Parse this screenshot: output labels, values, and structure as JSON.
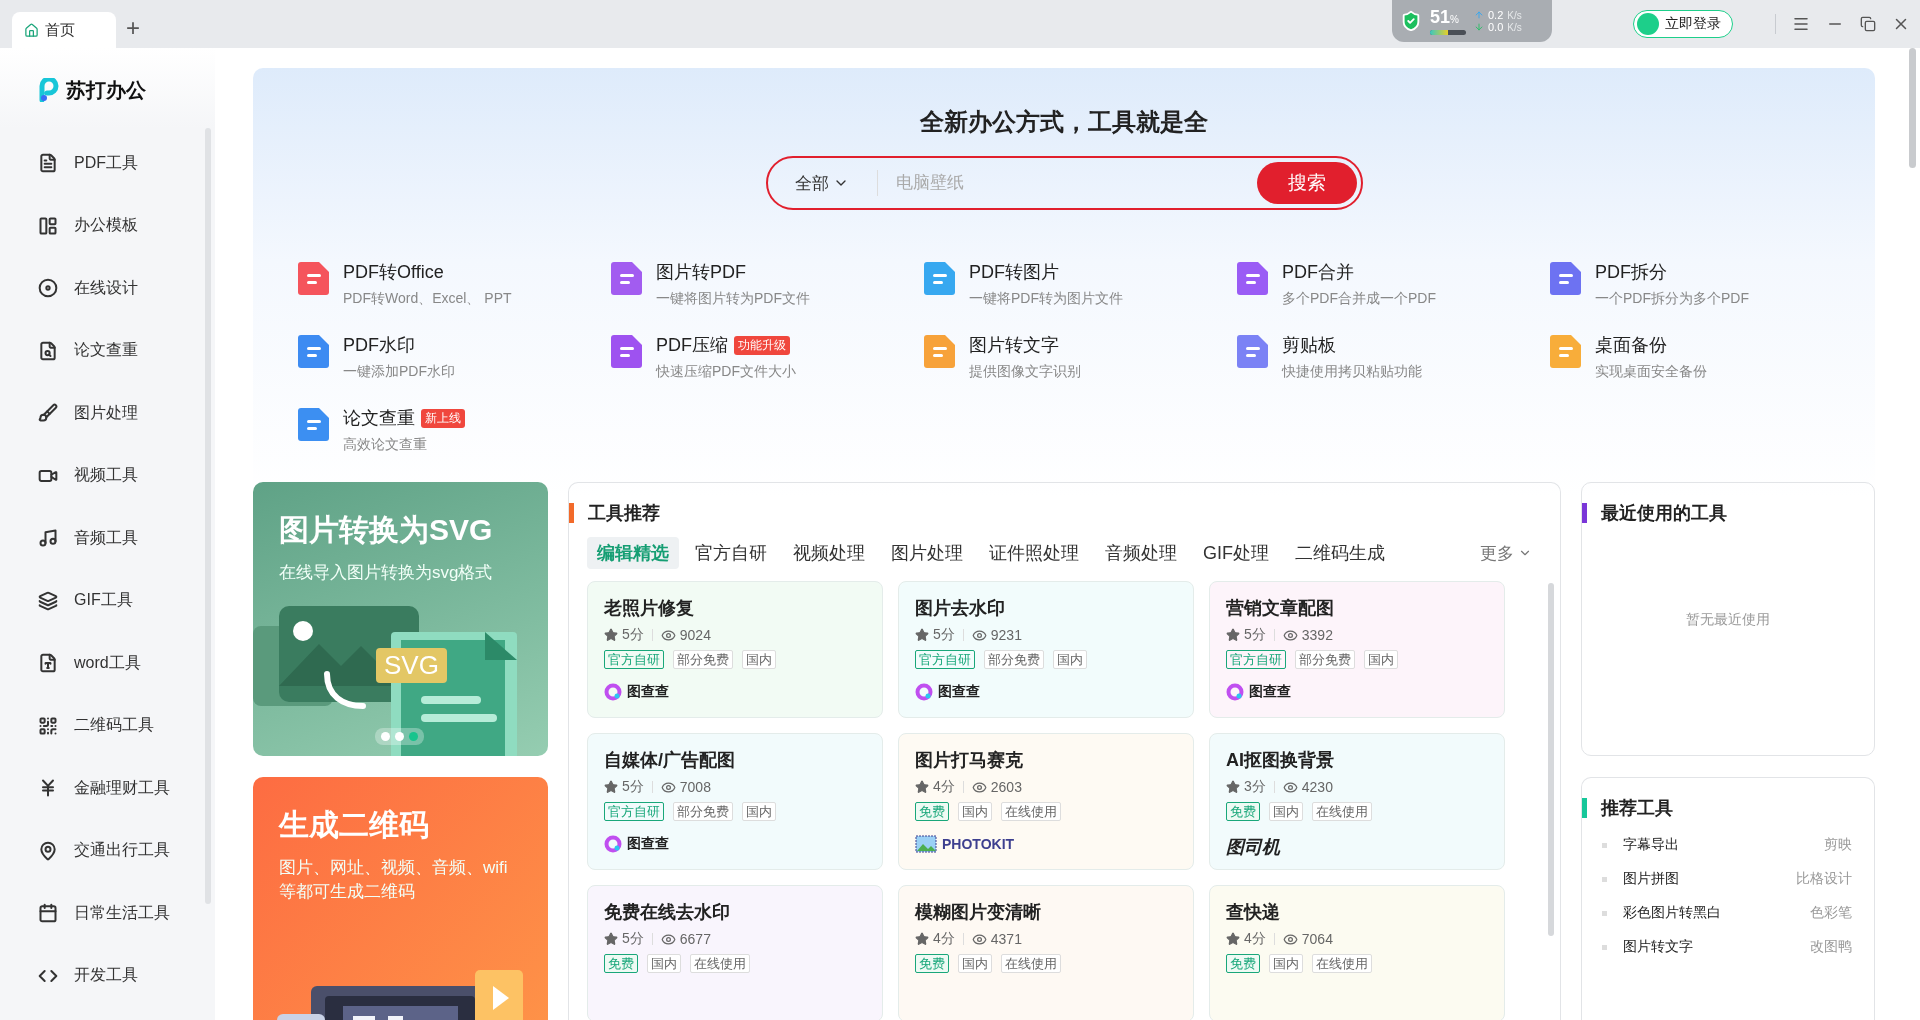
{
  "tabs": [
    {
      "label": "首页",
      "selected": true
    }
  ],
  "new_tab": "+",
  "status": {
    "percent": "51",
    "unit": "%",
    "level": 0.5,
    "upload": "0.2",
    "download": "0.0",
    "upload_unit": "K/s",
    "download_unit": "K/s"
  },
  "login": "立即登录",
  "sidebar": {
    "logo": "苏打办公",
    "items": [
      {
        "label": "PDF工具",
        "kind": "pdf"
      },
      {
        "label": "办公模板",
        "kind": "template"
      },
      {
        "label": "在线设计",
        "kind": "design"
      },
      {
        "label": "论文查重",
        "kind": "paper"
      },
      {
        "label": "图片处理",
        "kind": "image"
      },
      {
        "label": "视频工具",
        "kind": "video"
      },
      {
        "label": "音频工具",
        "kind": "audio"
      },
      {
        "label": "GIF工具",
        "kind": "gif"
      },
      {
        "label": "word工具",
        "kind": "word"
      },
      {
        "label": "二维码工具",
        "kind": "qr"
      },
      {
        "label": "金融理财工具",
        "kind": "finance"
      },
      {
        "label": "交通出行工具",
        "kind": "travel"
      },
      {
        "label": "日常生活工具",
        "kind": "daily"
      },
      {
        "label": "开发工具",
        "kind": "dev"
      }
    ]
  },
  "hero": {
    "title": "全新办公方式，工具就是全",
    "scope": "全部",
    "placeholder": "电脑壁纸",
    "button": "搜索"
  },
  "tools": [
    {
      "name": "PDF转Office",
      "desc": "PDF转Word、Excel、 PPT",
      "color": "#f5545c"
    },
    {
      "name": "图片转PDF",
      "desc": "一键将图片转为PDF文件",
      "color": "#a25cf0"
    },
    {
      "name": "PDF转图片",
      "desc": "一键将PDF转为图片文件",
      "color": "#37a8f0"
    },
    {
      "name": "PDF合并",
      "desc": "多个PDF合并成一个PDF",
      "color": "#9a5cf5"
    },
    {
      "name": "PDF拆分",
      "desc": "一个PDF拆分为多个PDF",
      "color": "#6d72f2"
    },
    {
      "name": "PDF水印",
      "desc": "一键添加PDF水印",
      "color": "#3d8bf2"
    },
    {
      "name": "PDF压缩",
      "desc": "快速压缩PDF文件大小",
      "badge": "功能升级",
      "color": "#9e52f0"
    },
    {
      "name": "图片转文字",
      "desc": "提供图像文字识别",
      "color": "#f7a23a"
    },
    {
      "name": "剪贴板",
      "desc": "快捷使用拷贝粘贴功能",
      "color": "#7b82f5"
    },
    {
      "name": "桌面备份",
      "desc": "实现桌面安全备份",
      "color": "#f8ad3a"
    },
    {
      "name": "论文查重",
      "desc": "高效论文查重",
      "badge": "新上线",
      "color": "#3c8ff2"
    }
  ],
  "banners": [
    {
      "kind": "svg",
      "title": "图片转换为SVG",
      "desc": "在线导入图片转换为svg格式",
      "label": "SVG",
      "dots": [
        {
          "selected": false
        },
        {
          "selected": false
        },
        {
          "selected": true
        }
      ]
    },
    {
      "kind": "qr",
      "title": "生成二维码",
      "desc": "图片、网址、视频、音频、wifi等都可生成二维码"
    }
  ],
  "recommend": {
    "title": "工具推荐",
    "tabs": [
      {
        "label": "编辑精选",
        "selected": true
      },
      {
        "label": "官方自研",
        "selected": false
      },
      {
        "label": "视频处理",
        "selected": false
      },
      {
        "label": "图片处理",
        "selected": false
      },
      {
        "label": "证件照处理",
        "selected": false
      },
      {
        "label": "音频处理",
        "selected": false
      },
      {
        "label": "GIF处理",
        "selected": false
      },
      {
        "label": "二维码生成",
        "selected": false
      }
    ],
    "more": "更多",
    "cards": [
      {
        "title": "老照片修复",
        "rating": "5分",
        "views": "9024",
        "color": "#f2fbf4",
        "tags": [
          {
            "text": "官方自研",
            "kind": "green"
          },
          {
            "text": "部分免费",
            "kind": "plain"
          },
          {
            "text": "国内",
            "kind": "plain"
          }
        ],
        "brand": {
          "kind": "tuchacha",
          "name": "图查查"
        }
      },
      {
        "title": "图片去水印",
        "rating": "5分",
        "views": "9231",
        "color": "#f2fcfc",
        "tags": [
          {
            "text": "官方自研",
            "kind": "green"
          },
          {
            "text": "部分免费",
            "kind": "plain"
          },
          {
            "text": "国内",
            "kind": "plain"
          }
        ],
        "brand": {
          "kind": "tuchacha",
          "name": "图查查"
        }
      },
      {
        "title": "营销文章配图",
        "rating": "5分",
        "views": "3392",
        "color": "#fdf4fa",
        "tags": [
          {
            "text": "官方自研",
            "kind": "green"
          },
          {
            "text": "部分免费",
            "kind": "plain"
          },
          {
            "text": "国内",
            "kind": "plain"
          }
        ],
        "brand": {
          "kind": "tuchacha",
          "name": "图查查"
        }
      },
      {
        "title": "自媒体/广告配图",
        "rating": "5分",
        "views": "7008",
        "color": "#f2fbfc",
        "tags": [
          {
            "text": "官方自研",
            "kind": "green"
          },
          {
            "text": "部分免费",
            "kind": "plain"
          },
          {
            "text": "国内",
            "kind": "plain"
          }
        ],
        "brand": {
          "kind": "tuchacha",
          "name": "图查查"
        }
      },
      {
        "title": "图片打马赛克",
        "rating": "4分",
        "views": "2603",
        "color": "#fefaf3",
        "tags": [
          {
            "text": "免费",
            "kind": "free"
          },
          {
            "text": "国内",
            "kind": "plain"
          },
          {
            "text": "在线使用",
            "kind": "plain"
          }
        ],
        "brand": {
          "kind": "photokit",
          "name": "PHOTOKIT"
        }
      },
      {
        "title": "AI抠图换背景",
        "rating": "3分",
        "views": "4230",
        "color": "#f2fbfc",
        "tags": [
          {
            "text": "免费",
            "kind": "free"
          },
          {
            "text": "国内",
            "kind": "plain"
          },
          {
            "text": "在线使用",
            "kind": "plain"
          }
        ],
        "brand": {
          "kind": "tusiji",
          "name": "图司机"
        }
      },
      {
        "title": "免费在线去水印",
        "rating": "5分",
        "views": "6677",
        "color": "#f9f5fd",
        "tags": [
          {
            "text": "免费",
            "kind": "free"
          },
          {
            "text": "国内",
            "kind": "plain"
          },
          {
            "text": "在线使用",
            "kind": "plain"
          }
        ]
      },
      {
        "title": "模糊图片变清晰",
        "rating": "4分",
        "views": "4371",
        "color": "#fef9f3",
        "tags": [
          {
            "text": "免费",
            "kind": "free"
          },
          {
            "text": "国内",
            "kind": "plain"
          },
          {
            "text": "在线使用",
            "kind": "plain"
          }
        ]
      },
      {
        "title": "查快递",
        "rating": "4分",
        "views": "7064",
        "color": "#fcfbf1",
        "tags": [
          {
            "text": "免费",
            "kind": "free"
          },
          {
            "text": "国内",
            "kind": "plain"
          },
          {
            "text": "在线使用",
            "kind": "plain"
          }
        ]
      }
    ]
  },
  "recent": {
    "title": "最近使用的工具",
    "empty": "暂无最近使用"
  },
  "suggested": {
    "title": "推荐工具",
    "items": [
      {
        "name": "字幕导出",
        "source": "剪映"
      },
      {
        "name": "图片拼图",
        "source": "比格设计"
      },
      {
        "name": "彩色图片转黑白",
        "source": "色彩笔"
      },
      {
        "name": "图片转文字",
        "source": "改图鸭"
      }
    ]
  }
}
